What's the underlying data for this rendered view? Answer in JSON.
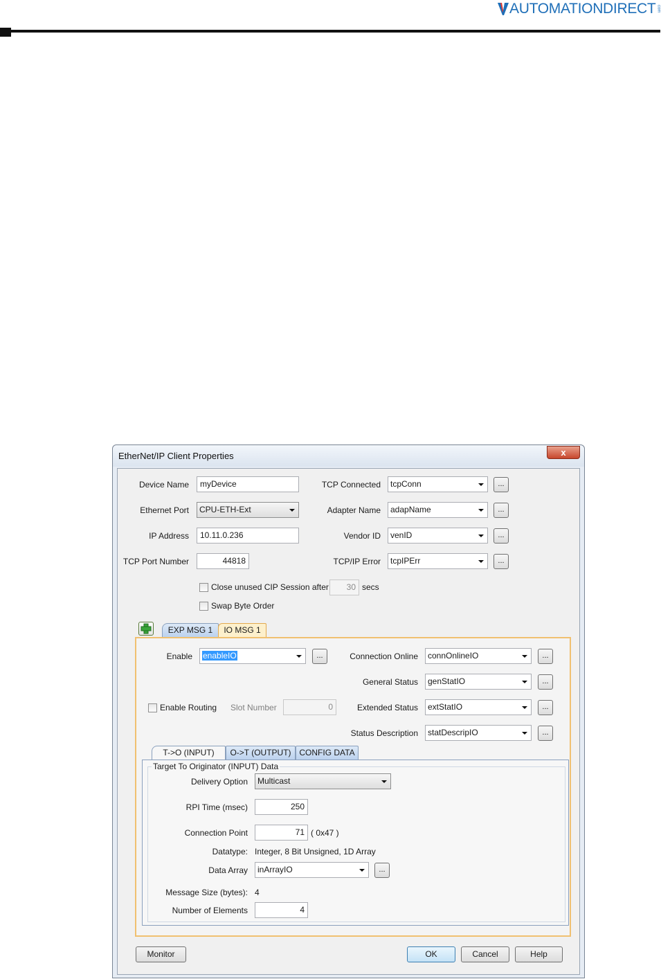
{
  "header": {
    "brand": "AUTOMATIONDIRECT",
    "brand_suffix": "com"
  },
  "dialog": {
    "title": "EtherNet/IP Client Properties",
    "close_label": "x",
    "device_name": {
      "label": "Device Name",
      "value": "myDevice"
    },
    "ethernet_port": {
      "label": "Ethernet Port",
      "value": "CPU-ETH-Ext"
    },
    "ip_address": {
      "label": "IP Address",
      "value": "10.11.0.236"
    },
    "tcp_port": {
      "label": "TCP Port Number",
      "value": "44818"
    },
    "tcp_connected": {
      "label": "TCP Connected",
      "value": "tcpConn"
    },
    "adapter_name": {
      "label": "Adapter Name",
      "value": "adapName"
    },
    "vendor_id": {
      "label": "Vendor ID",
      "value": "venID"
    },
    "tcpip_error": {
      "label": "TCP/IP Error",
      "value": "tcpIPErr"
    },
    "close_unused": {
      "label": "Close unused CIP Session after",
      "value": "30",
      "unit": "secs"
    },
    "swap_byte": {
      "label": "Swap Byte Order"
    },
    "ellipsis": "...",
    "tabs": [
      {
        "label": "EXP MSG 1"
      },
      {
        "label": "IO MSG 1"
      }
    ],
    "io": {
      "enable": {
        "label": "Enable",
        "value": "enableIO"
      },
      "enable_routing": {
        "label": "Enable Routing"
      },
      "slot_number": {
        "label": "Slot Number",
        "value": "0"
      },
      "connection_online": {
        "label": "Connection Online",
        "value": "connOnlineIO"
      },
      "general_status": {
        "label": "General Status",
        "value": "genStatIO"
      },
      "extended_status": {
        "label": "Extended Status",
        "value": "extStatIO"
      },
      "status_description": {
        "label": "Status Description",
        "value": "statDescripIO"
      },
      "subtabs": [
        {
          "label": "T->O (INPUT)"
        },
        {
          "label": "O->T (OUTPUT)"
        },
        {
          "label": "CONFIG DATA"
        }
      ],
      "group_title": "Target To Originator (INPUT) Data",
      "delivery_option": {
        "label": "Delivery Option",
        "value": "Multicast"
      },
      "rpi_time": {
        "label": "RPI Time (msec)",
        "value": "250"
      },
      "connection_point": {
        "label": "Connection Point",
        "value": "71",
        "hex": "( 0x47 )"
      },
      "datatype": {
        "label": "Datatype:",
        "value": "Integer, 8 Bit Unsigned, 1D Array"
      },
      "data_array": {
        "label": "Data Array",
        "value": "inArrayIO"
      },
      "message_size": {
        "label": "Message Size (bytes):",
        "value": "4"
      },
      "num_elements": {
        "label": "Number of Elements",
        "value": "4"
      }
    },
    "buttons": {
      "monitor": "Monitor",
      "ok": "OK",
      "cancel": "Cancel",
      "help": "Help"
    }
  }
}
